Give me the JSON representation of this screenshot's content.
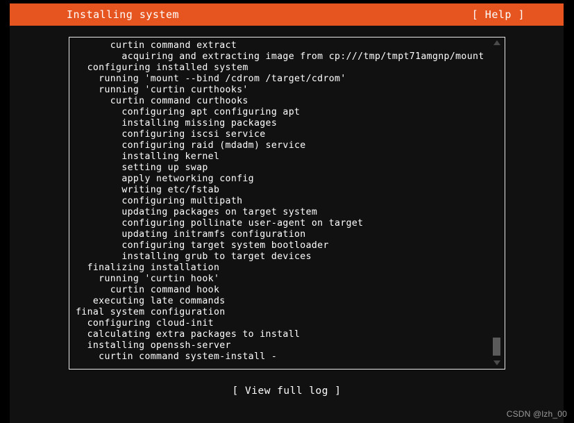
{
  "header": {
    "title": "Installing system",
    "help_label": "[ Help ]",
    "background_color": "#e6541f",
    "text_color": "#ffffff"
  },
  "log": {
    "lines": [
      "      curtin command extract",
      "        acquiring and extracting image from cp:///tmp/tmpt71amgnp/mount",
      "  configuring installed system",
      "    running 'mount --bind /cdrom /target/cdrom'",
      "    running 'curtin curthooks'",
      "      curtin command curthooks",
      "        configuring apt configuring apt",
      "        installing missing packages",
      "        configuring iscsi service",
      "        configuring raid (mdadm) service",
      "        installing kernel",
      "        setting up swap",
      "        apply networking config",
      "        writing etc/fstab",
      "        configuring multipath",
      "        updating packages on target system",
      "        configuring pollinate user-agent on target",
      "        updating initramfs configuration",
      "        configuring target system bootloader",
      "        installing grub to target devices",
      "  finalizing installation",
      "    running 'curtin hook'",
      "      curtin command hook",
      "   executing late commands",
      "final system configuration",
      "  configuring cloud-init",
      "  calculating extra packages to install",
      "  installing openssh-server",
      "    curtin command system-install -"
    ],
    "scrollbar": {
      "up_arrow": "scroll-up-arrow",
      "down_arrow": "scroll-down-arrow",
      "thumb": "scroll-thumb"
    }
  },
  "footer": {
    "view_full_log_label": "[ View full log ]"
  },
  "watermark": {
    "text": "CSDN @lzh_00"
  }
}
